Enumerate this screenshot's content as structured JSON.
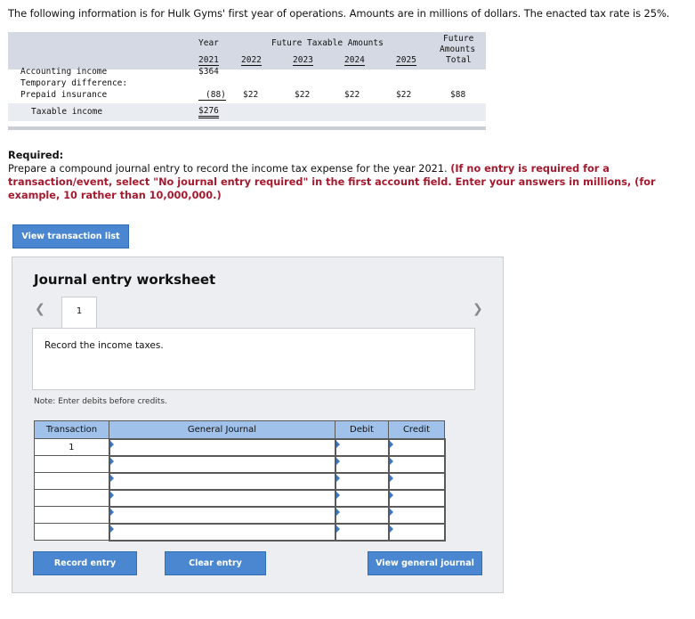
{
  "intro": "The following information is for Hulk Gyms' first year of operations. Amounts are in millions of dollars. The enacted tax rate is 25%.",
  "tax_table": {
    "col_year": "Year",
    "col_future_taxable": "Future Taxable Amounts",
    "col_future_total_1": "Future",
    "col_future_total_2": "Amounts",
    "col_future_total_3": "Total",
    "years": [
      "2021",
      "2022",
      "2023",
      "2024",
      "2025"
    ],
    "rows": {
      "accounting_income": {
        "label": "Accounting income",
        "v2021": "$364"
      },
      "temporary_difference": {
        "label": "Temporary difference:"
      },
      "prepaid_insurance": {
        "label": "Prepaid insurance",
        "v2021": "(88)",
        "v2022": "$22",
        "v2023": "$22",
        "v2024": "$22",
        "v2025": "$22",
        "total": "$88"
      },
      "taxable_income": {
        "label": "Taxable income",
        "v2021": "$276"
      }
    }
  },
  "required": {
    "heading": "Required:",
    "text": "Prepare a compound journal entry to record the income tax expense for the year 2021.",
    "instruction": "(If no entry is required for a transaction/event, select \"No journal entry required\" in the first account field. Enter your answers in millions, (for example, 10 rather than 10,000,000.)"
  },
  "buttons": {
    "view_transaction_list": "View transaction list",
    "record_entry": "Record entry",
    "clear_entry": "Clear entry",
    "view_general_journal": "View general journal"
  },
  "worksheet": {
    "title": "Journal entry worksheet",
    "tab_number": "1",
    "description": "Record the income taxes.",
    "note": "Note: Enter debits before credits.",
    "nav_prev_icon": "chevron-left-icon",
    "nav_next_icon": "chevron-right-icon"
  },
  "journal": {
    "headers": [
      "Transaction",
      "General Journal",
      "Debit",
      "Credit"
    ],
    "rows": [
      {
        "transaction": "1",
        "account": "",
        "debit": "",
        "credit": ""
      },
      {
        "transaction": "",
        "account": "",
        "debit": "",
        "credit": ""
      },
      {
        "transaction": "",
        "account": "",
        "debit": "",
        "credit": ""
      },
      {
        "transaction": "",
        "account": "",
        "debit": "",
        "credit": ""
      },
      {
        "transaction": "",
        "account": "",
        "debit": "",
        "credit": ""
      },
      {
        "transaction": "",
        "account": "",
        "debit": "",
        "credit": ""
      }
    ]
  },
  "colors": {
    "button_blue": "#4a87d0",
    "header_blue": "#9fc1ea",
    "required_red": "#a6192e"
  }
}
